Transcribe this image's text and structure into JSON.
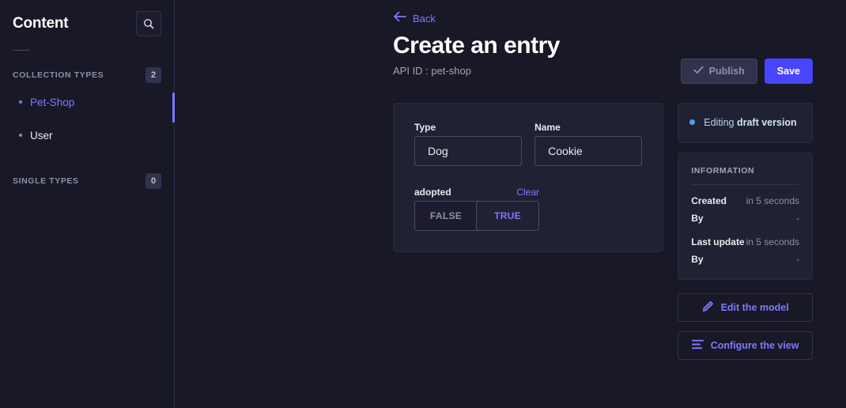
{
  "sidebar": {
    "title": "Content",
    "search_icon": "search-icon",
    "groups": [
      {
        "label": "COLLECTION TYPES",
        "badge": "2",
        "items": [
          {
            "label": "Pet-Shop",
            "active": true
          },
          {
            "label": "User",
            "active": false
          }
        ]
      },
      {
        "label": "SINGLE TYPES",
        "badge": "0",
        "items": []
      }
    ]
  },
  "header": {
    "back_label": "Back",
    "back_icon": "arrow-left-icon",
    "title": "Create an entry",
    "api_id": "API ID : pet-shop",
    "publish_label": "Publish",
    "publish_icon": "check-icon",
    "save_label": "Save"
  },
  "form": {
    "fields": [
      {
        "label": "Type",
        "value": "Dog",
        "placeholder": ""
      },
      {
        "label": "Name",
        "value": "Cookie",
        "placeholder": ""
      }
    ],
    "boolean_field": {
      "label": "adopted",
      "clear_label": "Clear",
      "options": [
        "FALSE",
        "TRUE"
      ],
      "selected": "TRUE"
    }
  },
  "right": {
    "draft": {
      "prefix": "Editing ",
      "emphasis": "draft version"
    },
    "information": {
      "title": "INFORMATION",
      "rows": [
        {
          "key": "Created",
          "value": "in 5 seconds"
        },
        {
          "key": "By",
          "value": "-"
        },
        {
          "key": "Last update",
          "value": "in 5 seconds"
        },
        {
          "key": "By",
          "value": "-"
        }
      ]
    },
    "actions": [
      {
        "label": "Edit the model",
        "icon": "pencil-icon"
      },
      {
        "label": "Configure the view",
        "icon": "list-lines-icon"
      }
    ]
  },
  "colors": {
    "background": "#181826",
    "surface": "#212134",
    "accent": "#7b79ff",
    "primary_button": "#4945ff",
    "border": "#32324d",
    "draft_blue": "#4a9fe8"
  }
}
